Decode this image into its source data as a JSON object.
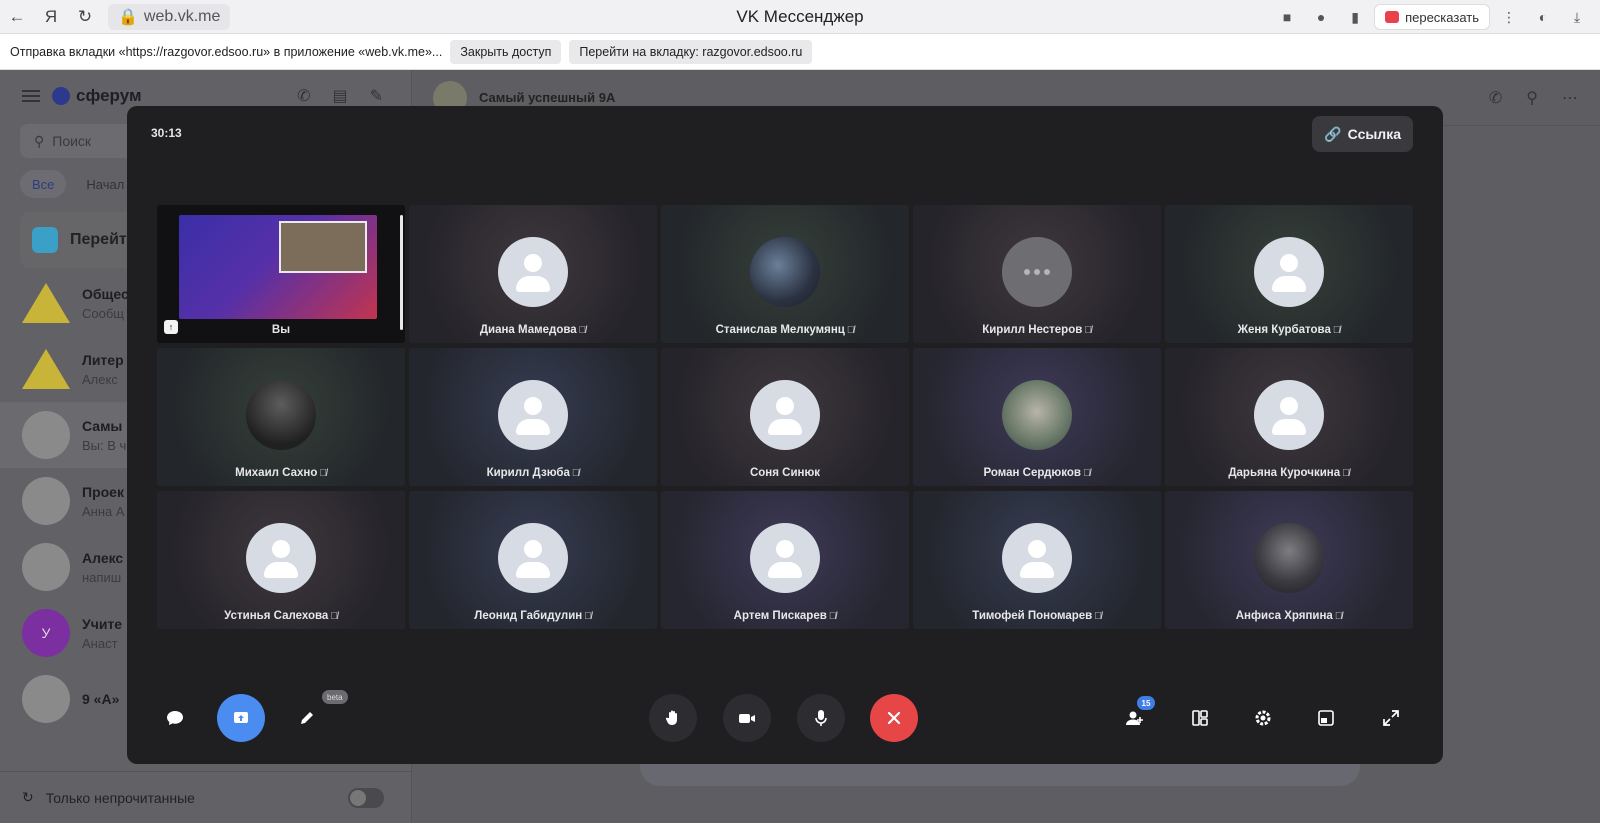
{
  "browser": {
    "url": "web.vk.me",
    "title": "VK Мессенджер",
    "retell_label": "пересказать",
    "notice_text": "Отправка вкладки «https://razgovor.edsoo.ru» в приложение «web.vk.me»...",
    "close_access_label": "Закрыть доступ",
    "go_to_tab_label": "Перейти на вкладку: razgovor.edsoo.ru"
  },
  "sidebar": {
    "brand": "сферум",
    "search_placeholder": "Поиск",
    "filters": [
      "Все",
      "Начал"
    ],
    "goto_label": "Перейт",
    "chats": [
      {
        "name": "Общес",
        "sub": "Сообщ"
      },
      {
        "name": "Литер",
        "sub": "Алекс"
      },
      {
        "name": "Самы",
        "sub": "Вы: В ч"
      },
      {
        "name": "Проек",
        "sub": "Анна А"
      },
      {
        "name": "Алекс",
        "sub": "напиш"
      },
      {
        "name": "Учите",
        "sub": "Анаст",
        "initial": "У"
      },
      {
        "name": "9 «А»",
        "sub": ""
      }
    ],
    "unread_only_label": "Только непрочитанные"
  },
  "chat_header": {
    "title": "Самый успешный 9А"
  },
  "call": {
    "timer": "30:13",
    "link_label": "Ссылка",
    "participants_count": "15",
    "beta_label": "beta",
    "participants": [
      {
        "name": "Вы",
        "kind": "self",
        "tone": "dark",
        "muted": false
      },
      {
        "name": "Диана Мамедова",
        "kind": "placeholder",
        "tone": "warm",
        "muted": true
      },
      {
        "name": "Станислав Мелкумянц",
        "kind": "photo-a",
        "tone": "green",
        "muted": true
      },
      {
        "name": "Кирилл Нестеров",
        "kind": "gray-dots",
        "tone": "warm",
        "muted": true
      },
      {
        "name": "Женя Курбатова",
        "kind": "placeholder",
        "tone": "green",
        "muted": true
      },
      {
        "name": "Михаил Сахно",
        "kind": "photo-b",
        "tone": "green",
        "muted": true
      },
      {
        "name": "Кирилл Дзюба",
        "kind": "placeholder",
        "tone": "blue",
        "muted": true
      },
      {
        "name": "Соня Синюк",
        "kind": "placeholder",
        "tone": "warm",
        "muted": false
      },
      {
        "name": "Роман Сердюков",
        "kind": "photo-c",
        "tone": "purple",
        "muted": true
      },
      {
        "name": "Дарьяна Курочкина",
        "kind": "placeholder",
        "tone": "warm",
        "muted": true
      },
      {
        "name": "Устинья Салехова",
        "kind": "placeholder",
        "tone": "warm",
        "muted": true
      },
      {
        "name": "Леонид Габидулин",
        "kind": "placeholder",
        "tone": "blue",
        "muted": true
      },
      {
        "name": "Артем Пискарев",
        "kind": "placeholder",
        "tone": "purple",
        "muted": true
      },
      {
        "name": "Тимофей Пономарев",
        "kind": "placeholder",
        "tone": "blue",
        "muted": true
      },
      {
        "name": "Анфиса Хряпина",
        "kind": "photo-d",
        "tone": "purple",
        "muted": true
      }
    ],
    "end_call_color": "#e64646",
    "screen_share_color": "#4b8cf0"
  }
}
